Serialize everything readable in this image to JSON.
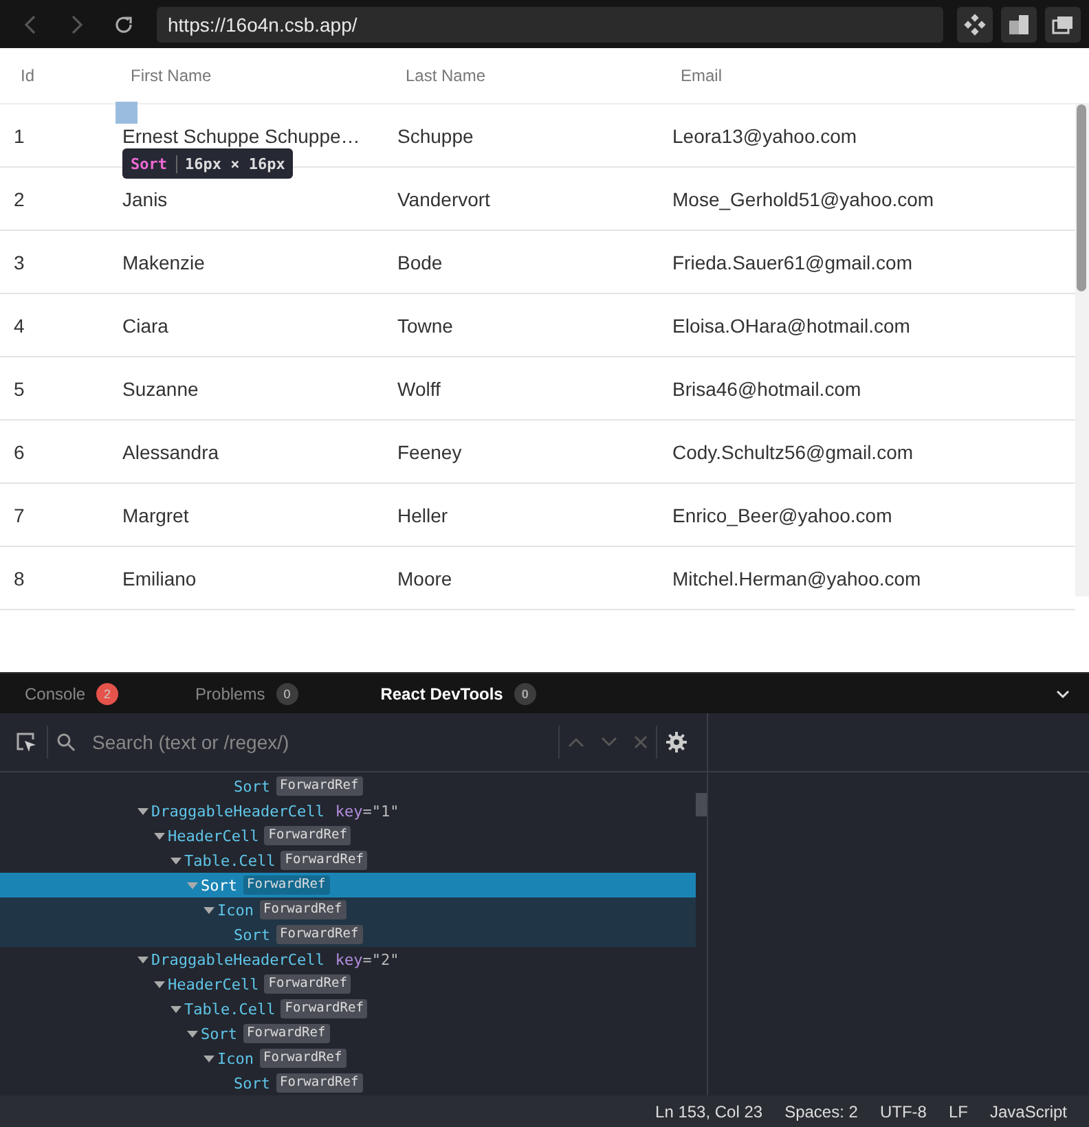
{
  "browser": {
    "url": "https://16o4n.csb.app/"
  },
  "table": {
    "columns": [
      "Id",
      "First Name",
      "Last Name",
      "Email"
    ],
    "rows": [
      [
        "1",
        "Ernest Schuppe Schuppe…",
        "Schuppe",
        "Leora13@yahoo.com"
      ],
      [
        "2",
        "Janis",
        "Vandervort",
        "Mose_Gerhold51@yahoo.com"
      ],
      [
        "3",
        "Makenzie",
        "Bode",
        "Frieda.Sauer61@gmail.com"
      ],
      [
        "4",
        "Ciara",
        "Towne",
        "Eloisa.OHara@hotmail.com"
      ],
      [
        "5",
        "Suzanne",
        "Wolff",
        "Brisa46@hotmail.com"
      ],
      [
        "6",
        "Alessandra",
        "Feeney",
        "Cody.Schultz56@gmail.com"
      ],
      [
        "7",
        "Margret",
        "Heller",
        "Enrico_Beer@yahoo.com"
      ],
      [
        "8",
        "Emiliano",
        "Moore",
        "Mitchel.Herman@yahoo.com"
      ]
    ]
  },
  "inspect_tooltip": {
    "name": "Sort",
    "size": "16px × 16px"
  },
  "devtools": {
    "tabs": [
      {
        "label": "Console",
        "count": "2",
        "color": "#e5534b",
        "selected": false
      },
      {
        "label": "Problems",
        "count": "0",
        "color": "#3d3d3d",
        "selected": false
      },
      {
        "label": "React DevTools",
        "count": "0",
        "color": "#3d3d3d",
        "selected": true
      }
    ],
    "search": {
      "placeholder": "Search (text or /regex/)"
    },
    "tree": {
      "leading": [
        {
          "name": "Sort",
          "badge": "ForwardRef",
          "selected": false
        }
      ],
      "items": [
        {
          "name": "DraggableHeaderCell",
          "prop": {
            "name": "key",
            "value": "=\"1\""
          },
          "selected": false,
          "expanded": true,
          "children": [
            {
              "name": "HeaderCell",
              "badge": "ForwardRef",
              "selected": false,
              "expanded": true,
              "children": [
                {
                  "name": "Table.Cell",
                  "badge": "ForwardRef",
                  "selected": false,
                  "expanded": true,
                  "children": [
                    {
                      "name": "Sort",
                      "badge": "ForwardRef",
                      "selected": true,
                      "expanded": true,
                      "children": [
                        {
                          "name": "Icon",
                          "badge": "ForwardRef",
                          "selected": false,
                          "expanded": true,
                          "children": [
                            {
                              "name": "Sort",
                              "badge": "ForwardRef",
                              "selected": false
                            }
                          ]
                        }
                      ]
                    }
                  ]
                }
              ]
            }
          ]
        },
        {
          "name": "DraggableHeaderCell",
          "prop": {
            "name": "key",
            "value": "=\"2\""
          },
          "selected": false,
          "expanded": true,
          "children": [
            {
              "name": "HeaderCell",
              "badge": "ForwardRef",
              "selected": false,
              "expanded": true,
              "children": [
                {
                  "name": "Table.Cell",
                  "badge": "ForwardRef",
                  "selected": false,
                  "expanded": true,
                  "children": [
                    {
                      "name": "Sort",
                      "badge": "ForwardRef",
                      "selected": false,
                      "expanded": true,
                      "children": [
                        {
                          "name": "Icon",
                          "badge": "ForwardRef",
                          "selected": false,
                          "expanded": true,
                          "children": [
                            {
                              "name": "Sort",
                              "badge": "ForwardRef",
                              "selected": false
                            }
                          ]
                        }
                      ]
                    }
                  ]
                }
              ]
            }
          ]
        }
      ]
    }
  },
  "status_bar": [
    "Ln 153, Col 23",
    "Spaces: 2",
    "UTF-8",
    "LF",
    "JavaScript"
  ]
}
